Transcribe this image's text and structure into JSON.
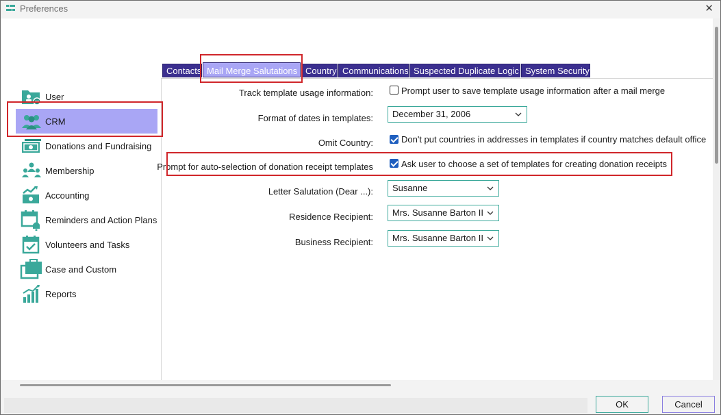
{
  "window": {
    "title": "Preferences",
    "close_glyph": "✕"
  },
  "sidebar": {
    "items": [
      {
        "label": "User",
        "icon": "user-card-icon"
      },
      {
        "label": "CRM",
        "icon": "people-group-icon",
        "selected": true
      },
      {
        "label": "Donations and Fundraising",
        "icon": "money-bill-icon"
      },
      {
        "label": "Membership",
        "icon": "membership-group-icon"
      },
      {
        "label": "Accounting",
        "icon": "accounting-chart-icon"
      },
      {
        "label": "Reminders and Action Plans",
        "icon": "calendar-bell-icon"
      },
      {
        "label": "Volunteers and Tasks",
        "icon": "calendar-check-icon"
      },
      {
        "label": "Case and Custom",
        "icon": "briefcase-icon"
      },
      {
        "label": "Reports",
        "icon": "bar-chart-icon"
      }
    ]
  },
  "tabs": [
    {
      "label": "Contacts"
    },
    {
      "label": "Mail Merge Salutations",
      "active": true
    },
    {
      "label": "Country"
    },
    {
      "label": "Communications"
    },
    {
      "label": "Suspected Duplicate Logic"
    },
    {
      "label": "System Security"
    }
  ],
  "form": {
    "track_usage": {
      "label": "Track template usage information:",
      "checkbox_text": "Prompt user to save template usage information after a mail merge",
      "checked": false
    },
    "date_format": {
      "label": "Format of dates in templates:",
      "value": "December 31, 2006"
    },
    "omit_country": {
      "label": "Omit Country:",
      "checkbox_text": "Don't put countries in addresses in templates if country matches default office",
      "checked": true
    },
    "auto_selection": {
      "label": "Prompt for auto-selection of donation receipt templates",
      "checkbox_text": "Ask user to choose a set of templates for creating donation receipts",
      "checked": true
    },
    "letter_salutation": {
      "label": "Letter Salutation (Dear ...):",
      "value": "Susanne"
    },
    "residence_recipient": {
      "label": "Residence Recipient:",
      "value": "Mrs. Susanne Barton II"
    },
    "business_recipient": {
      "label": "Business Recipient:",
      "value": "Mrs. Susanne Barton II"
    }
  },
  "footer": {
    "ok_label": "OK",
    "cancel_label": "Cancel"
  },
  "colors": {
    "accent_teal": "#3aa89a",
    "tab_dark": "#3b2f8f",
    "tab_active": "#a9a6f5",
    "highlight_red": "#d0262a",
    "checkbox_blue": "#1f5fbf"
  }
}
